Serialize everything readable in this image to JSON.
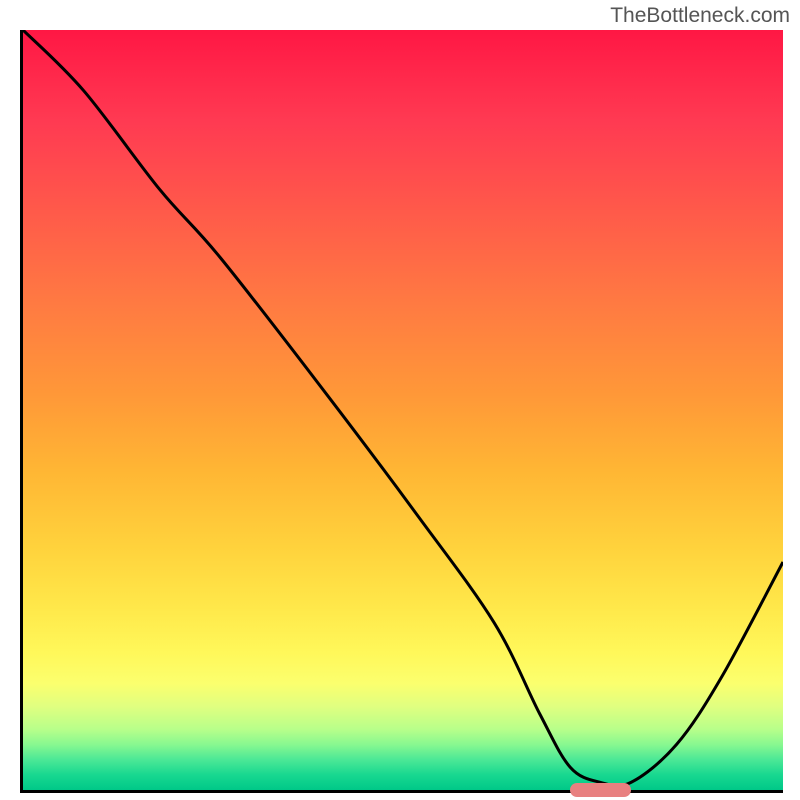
{
  "watermark": "TheBottleneck.com",
  "chart_data": {
    "type": "line",
    "title": "",
    "xlabel": "",
    "ylabel": "",
    "xlim": [
      0,
      100
    ],
    "ylim": [
      0,
      100
    ],
    "x": [
      0,
      8,
      18,
      26,
      40,
      52,
      62,
      68,
      72,
      76,
      80,
      86,
      92,
      100
    ],
    "values": [
      100,
      92,
      79,
      70,
      52,
      36,
      22,
      10,
      3,
      1,
      1,
      6,
      15,
      30
    ],
    "marker": {
      "x_start": 72,
      "x_end": 80,
      "y": 0
    },
    "background": "vertical-gradient-red-to-green"
  }
}
